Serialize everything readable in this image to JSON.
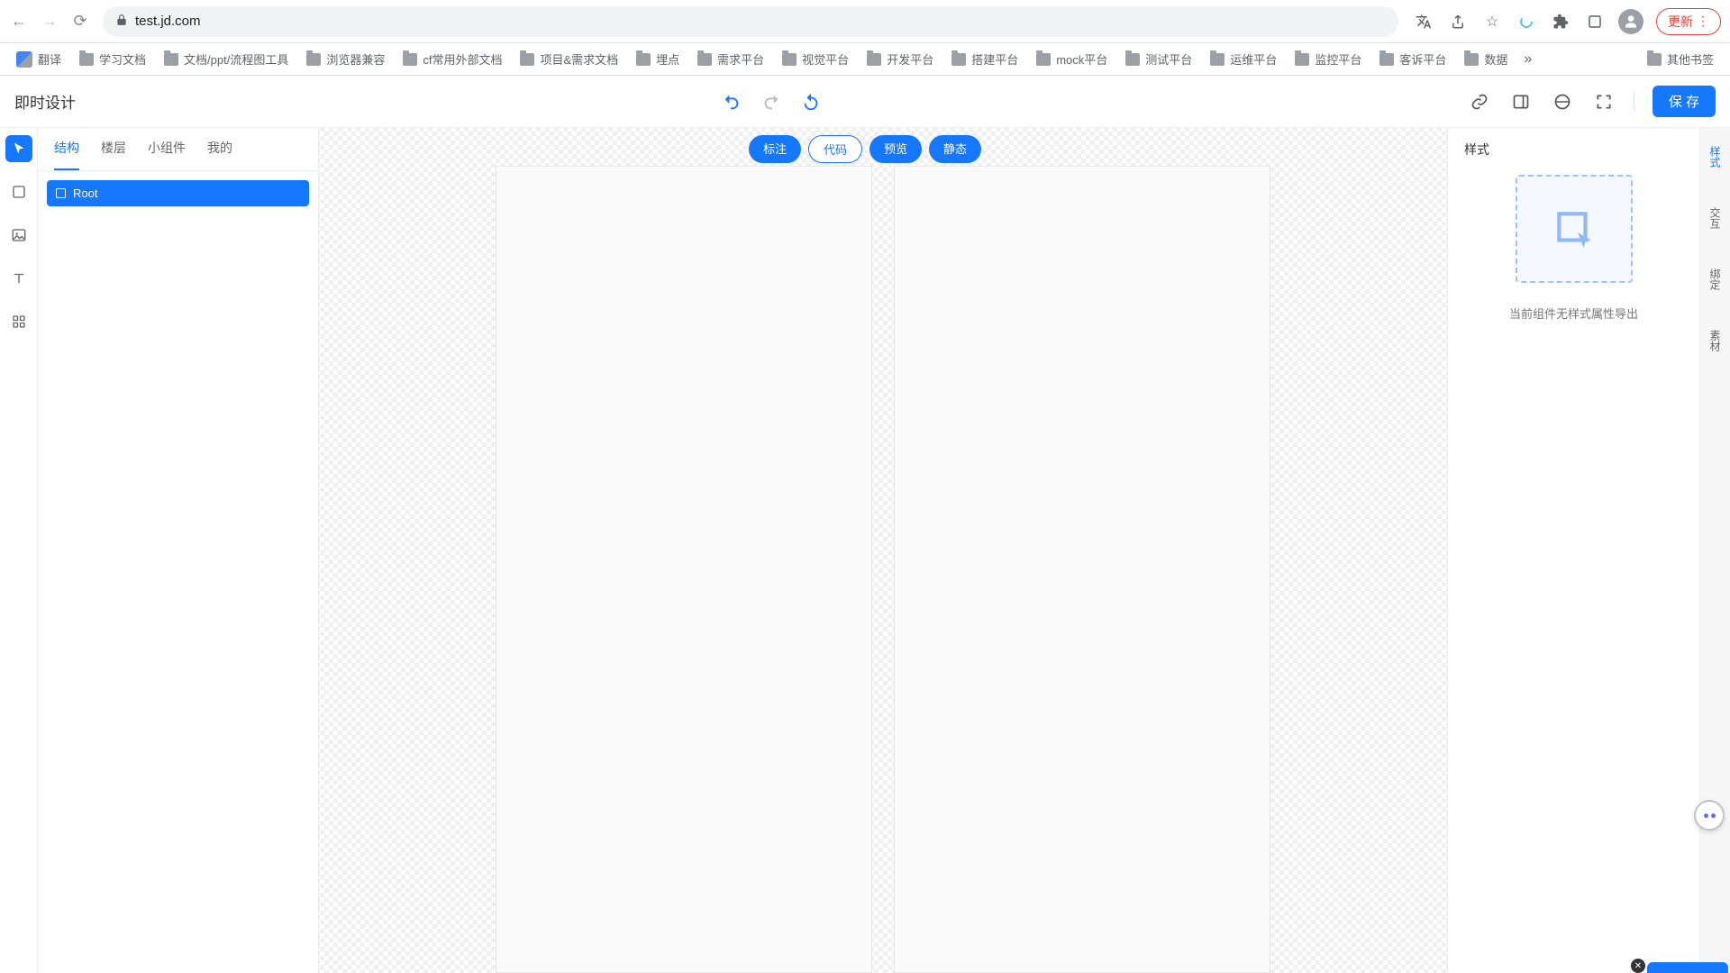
{
  "browser": {
    "url": "test.jd.com",
    "update_label": "更新"
  },
  "bookmarks": [
    {
      "label": "翻译",
      "icon": "translate"
    },
    {
      "label": "学习文档",
      "icon": "folder"
    },
    {
      "label": "文档/ppt/流程图工具",
      "icon": "folder"
    },
    {
      "label": "浏览器兼容",
      "icon": "folder"
    },
    {
      "label": "cf常用外部文档",
      "icon": "folder"
    },
    {
      "label": "项目&需求文档",
      "icon": "folder"
    },
    {
      "label": "埋点",
      "icon": "folder"
    },
    {
      "label": "需求平台",
      "icon": "folder"
    },
    {
      "label": "视觉平台",
      "icon": "folder"
    },
    {
      "label": "开发平台",
      "icon": "folder"
    },
    {
      "label": "搭建平台",
      "icon": "folder"
    },
    {
      "label": "mock平台",
      "icon": "folder"
    },
    {
      "label": "测试平台",
      "icon": "folder"
    },
    {
      "label": "运维平台",
      "icon": "folder"
    },
    {
      "label": "监控平台",
      "icon": "folder"
    },
    {
      "label": "客诉平台",
      "icon": "folder"
    },
    {
      "label": "数据",
      "icon": "folder"
    }
  ],
  "bookmarks_overflow": "»",
  "bookmarks_right": {
    "label": "其他书签",
    "icon": "folder"
  },
  "app": {
    "title": "即时设计",
    "save_label": "保 存"
  },
  "view_pills": [
    {
      "label": "标注",
      "style": "blue"
    },
    {
      "label": "代码",
      "style": "white"
    },
    {
      "label": "预览",
      "style": "blue"
    },
    {
      "label": "静态",
      "style": "blue"
    }
  ],
  "left_panel": {
    "tabs": [
      "结构",
      "楼层",
      "小组件",
      "我的"
    ],
    "active_tab": "结构",
    "tree": [
      {
        "label": "Root"
      }
    ]
  },
  "right_panel": {
    "title": "样式",
    "hint": "当前组件无样式属性导出"
  },
  "right_rail_tabs": [
    "样式",
    "交互",
    "绑定",
    "素材"
  ],
  "right_rail_active": "样式"
}
